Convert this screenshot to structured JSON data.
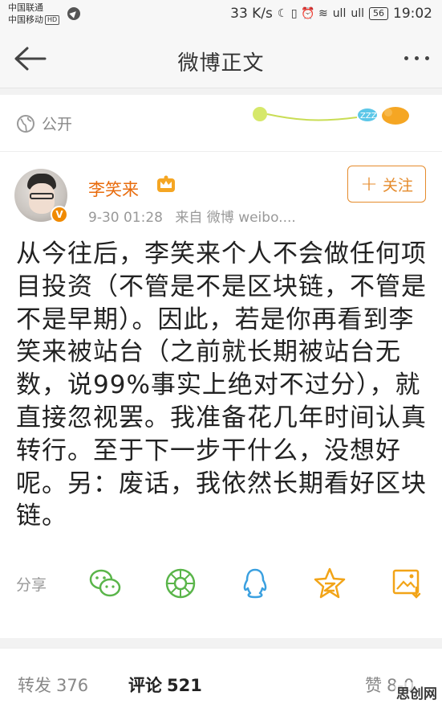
{
  "status_bar": {
    "carrier_1": "中国联通",
    "carrier_2": "中国移动",
    "hd": "HD",
    "speed": "33 K/s",
    "icons": "☾ ▯ ⏰ ≋",
    "signal_1": "ull",
    "signal_2": "ull",
    "battery": "56",
    "time": "19:02"
  },
  "header": {
    "title": "微博正文"
  },
  "post": {
    "visibility": "公开",
    "author": "李笑来",
    "time": "9-30 01:28",
    "source": "来自 微博 weibo....",
    "follow_label": "关注",
    "text": "从今往后，李笑来个人不会做任何项目投资（不管是不是区块链，不管是不是早期）。因此，若是你再看到李笑来被站台（之前就长期被站台无数，说99%事实上绝对不过分），就直接忽视罢。我准备花几年时间认真转行。至于下一步干什么，没想好呢。另：废话，我依然长期看好区块链。",
    "decor_text": "ZZZ"
  },
  "share": {
    "label": "分享",
    "icons": [
      "wechat-icon",
      "moments-icon",
      "qq-icon",
      "favorite-star-icon",
      "save-image-icon"
    ]
  },
  "bottom_tabs": {
    "repost_label": "转发",
    "repost_count": "376",
    "comment_label": "评论",
    "comment_count": "521",
    "like_label": "赞",
    "like_count": "8-0"
  },
  "watermark": "思创网",
  "colors": {
    "accent": "#e58b2c",
    "author": "#e86b0c",
    "share_green": "#5ab54a",
    "share_blue": "#3aa0e0",
    "share_yellow": "#f2a417"
  }
}
